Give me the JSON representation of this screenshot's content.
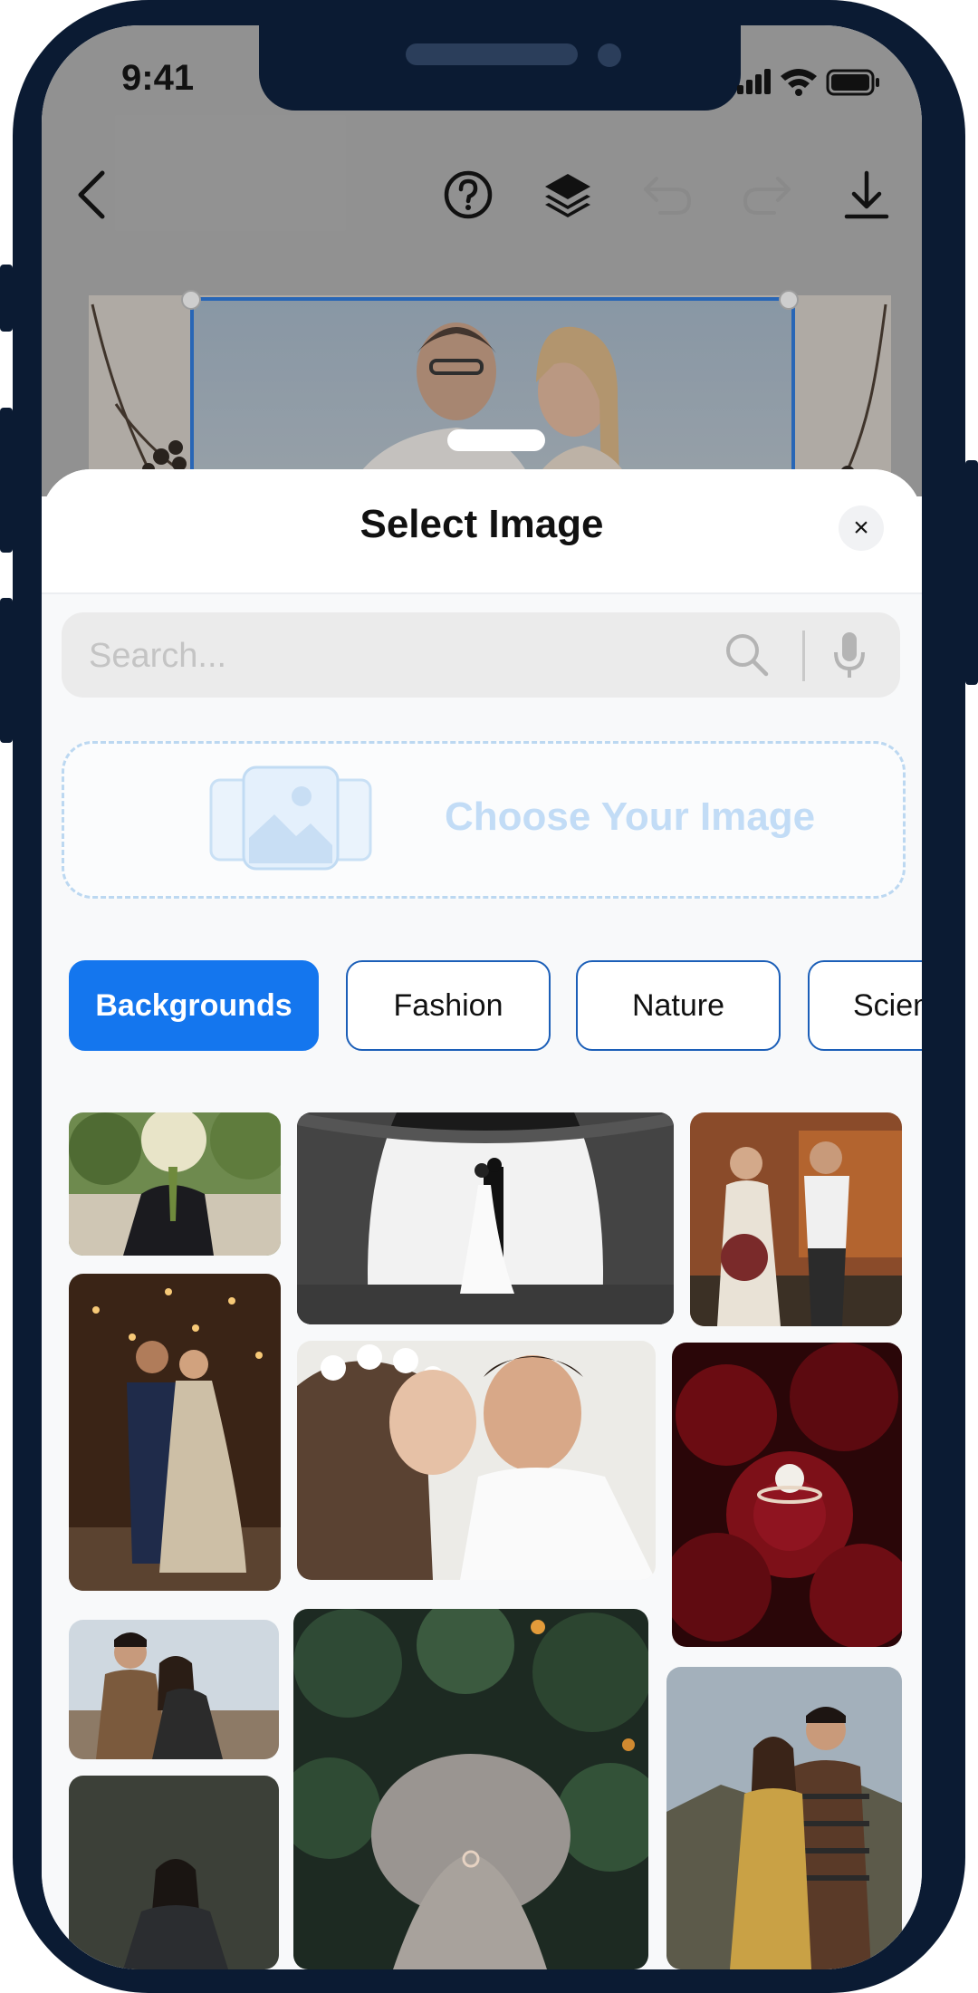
{
  "status_bar": {
    "time": "9:41"
  },
  "toolbar": {
    "icons": [
      "back-icon",
      "help-icon",
      "layers-icon",
      "undo-icon",
      "redo-icon",
      "download-icon"
    ]
  },
  "sheet": {
    "title": "Select Image",
    "close_label": "×",
    "search": {
      "placeholder": "Search...",
      "value": ""
    },
    "upload_label": "Choose Your Image",
    "categories": [
      "Backgrounds",
      "Fashion",
      "Nature",
      "Scien"
    ],
    "active_category": "Backgrounds"
  },
  "colors": {
    "accent": "#1476ee",
    "frame": "#0b1b33",
    "upload_text": "#c2dcf6"
  }
}
